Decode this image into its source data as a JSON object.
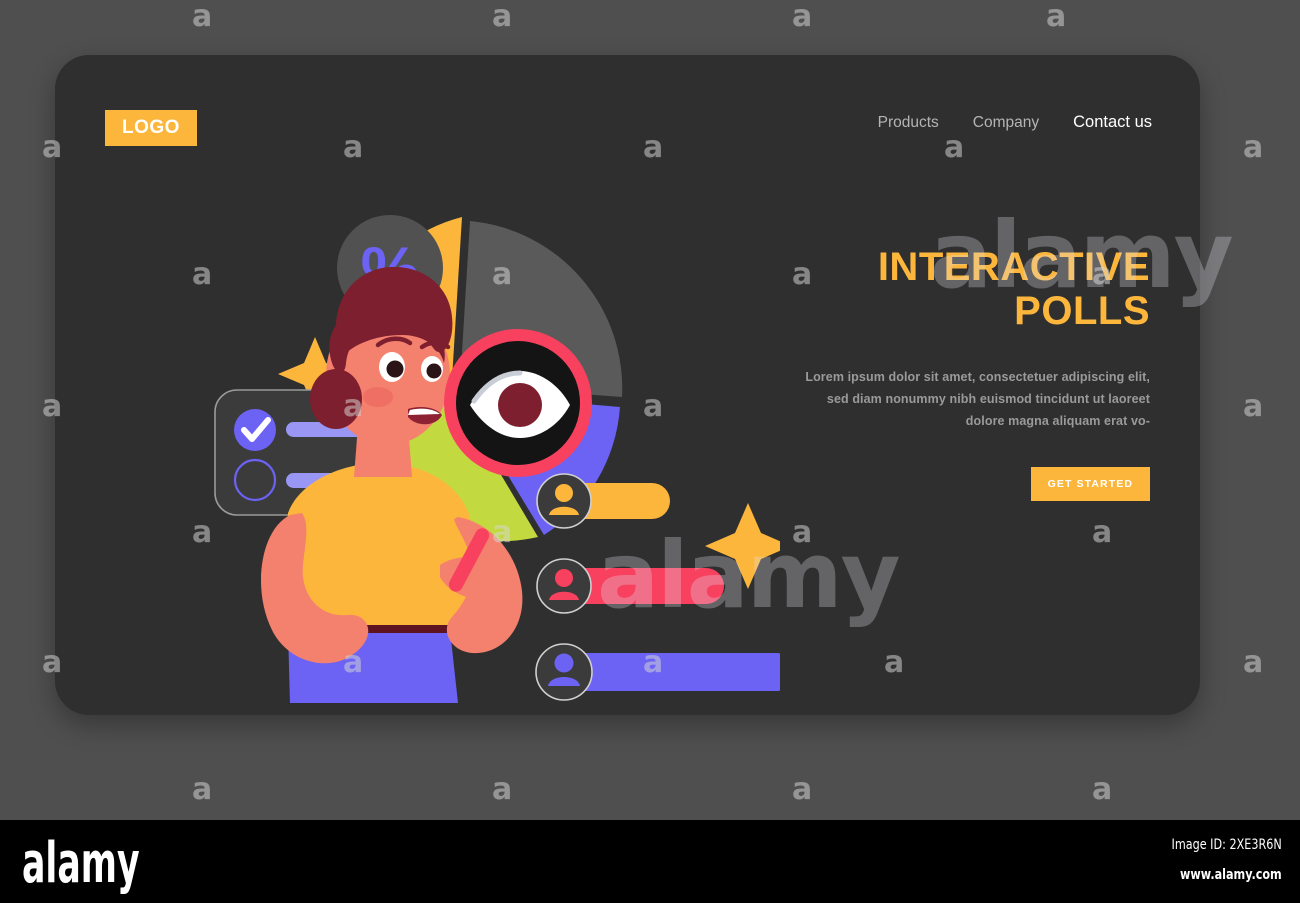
{
  "page": {
    "background_color": "#4f4f4f",
    "card_color": "#2f2f2f"
  },
  "header": {
    "logo_label": "LOGO",
    "nav": [
      {
        "label": "Products",
        "active": false
      },
      {
        "label": "Company",
        "active": false
      },
      {
        "label": "Contact us",
        "active": true
      }
    ]
  },
  "hero": {
    "headline_line1": "INTERACTIVE",
    "headline_line2": "POLLS",
    "headline_color": "#fdb63c",
    "paragraph": "Lorem ipsum dolor sit amet, consectetuer adipiscing elit, sed diam nonummy nibh euismod tincidunt ut laoreet dolore magna aliquam erat vo-",
    "cta_label": "GET STARTED",
    "cta_color": "#fdb63c"
  },
  "illustration": {
    "alt": "Woman holding a magnifying glass with an eye, in front of a pie chart and poll result bars",
    "percent_badge_symbol": "%",
    "percent_badge_color": "#6c63f5",
    "pie_chart": {
      "slices": [
        {
          "name": "gray-slice",
          "color": "#5a5a5a"
        },
        {
          "name": "amber-slice",
          "color": "#fdb63c"
        },
        {
          "name": "lime-slice",
          "color": "#c3d940"
        },
        {
          "name": "purple-slice",
          "color": "#6c63f5"
        }
      ]
    },
    "poll_bars": [
      {
        "name": "poll-bar-amber",
        "color": "#fdb63c",
        "avatar_color": "#fdb63c"
      },
      {
        "name": "poll-bar-pink",
        "color": "#f8405f",
        "avatar_color": "#f8405f"
      },
      {
        "name": "poll-bar-purple",
        "color": "#6c63f5",
        "avatar_color": "#6c63f5"
      }
    ],
    "checklist": {
      "item1_checked": true,
      "item2_checked": false,
      "accent_color": "#6c63f5"
    },
    "sparkle_color": "#fdb63c",
    "character": {
      "skin": "#f4806e",
      "hair": "#7d1f2e",
      "shirt": "#fdb63c",
      "pants": "#6c63f5"
    },
    "magnifier": {
      "ring_color": "#f8405f",
      "lens_color": "#141414",
      "iris_color": "#7d1f2e"
    }
  },
  "watermark": {
    "glyph": "a",
    "brand": "alamy"
  },
  "footer": {
    "logo": "alamy",
    "image_id": "Image ID: 2XE3R6N",
    "url": "www.alamy.com"
  }
}
